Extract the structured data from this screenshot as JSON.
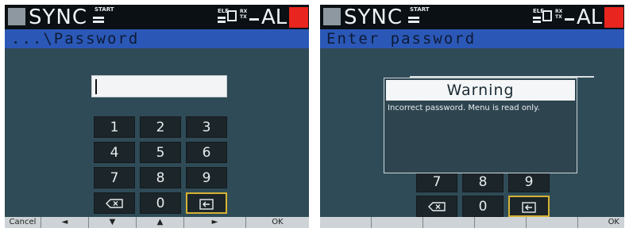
{
  "screens": [
    {
      "status": {
        "sync": "SYNC",
        "start": "START",
        "ele": "ELE",
        "rx": "RX",
        "tx": "TX",
        "al": "AL"
      },
      "title": "...\\Password",
      "keypad": {
        "rows": [
          [
            "1",
            "2",
            "3"
          ],
          [
            "4",
            "5",
            "6"
          ],
          [
            "7",
            "8",
            "9"
          ]
        ],
        "zero": "0"
      },
      "softkeys": [
        "Cancel",
        "◄",
        "▼",
        "▲",
        "►",
        "OK"
      ]
    },
    {
      "status": {
        "sync": "SYNC",
        "start": "START",
        "ele": "ELE",
        "rx": "RX",
        "tx": "TX",
        "al": "AL"
      },
      "title": "Enter password",
      "dialog": {
        "title": "Warning",
        "message": "Incorrect password. Menu is read only."
      },
      "keypad": {
        "rows": [
          [
            "7",
            "8",
            "9"
          ]
        ],
        "zero": "0"
      },
      "softkeys": [
        "",
        "",
        "",
        "",
        "",
        "OK"
      ]
    }
  ],
  "colors": {
    "status_bg": "#0b1014",
    "title_bg": "#2b58b6",
    "body_bg": "#2f4b57",
    "alarm": "#e8251e",
    "key_selected": "#d6b232"
  }
}
